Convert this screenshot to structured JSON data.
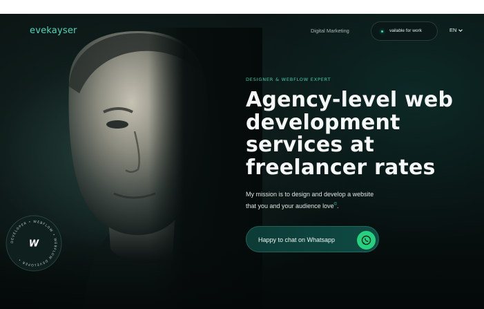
{
  "nav": {
    "logo": "evekayser",
    "link": "Digital Marketing",
    "availability": "vailable for work",
    "language": "EN"
  },
  "hero": {
    "eyebrow": "DESIGNER & WEBFLOW EXPERT",
    "headline_lines": [
      "Agency-level web",
      "development",
      "services at",
      "freelancer rates"
    ],
    "mission_lines": [
      "My mission is to design and develop a website",
      "that you and your audience love"
    ],
    "mission_sup": "©",
    "mission_end": ".",
    "cta_label": "Happy to chat on Whatsapp"
  },
  "badge": {
    "text": "DEVELOPER • WEBFLOW • WEBFLOW DEVELOPER •",
    "mark": "W"
  },
  "colors": {
    "accent": "#3fd2b0",
    "background": "#060d0d",
    "cta_fill": "#0f4a43",
    "whatsapp": "#27d07e"
  },
  "icons": [
    "whatsapp-icon",
    "chevron-down-icon",
    "webflow-logo-icon"
  ]
}
